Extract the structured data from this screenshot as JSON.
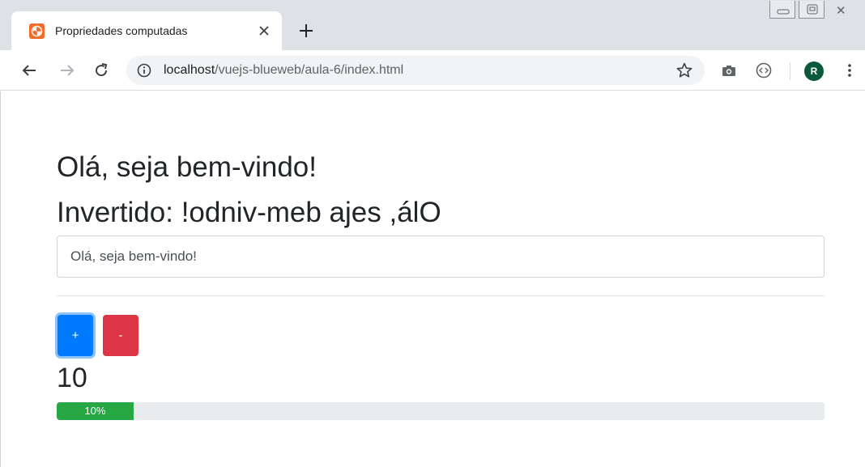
{
  "browser": {
    "tab_title": "Propriedades computadas",
    "url_host": "localhost",
    "url_path": "/vuejs-blueweb/aula-6/index.html",
    "avatar_initial": "R"
  },
  "page": {
    "greeting": "Olá, seja bem-vindo!",
    "inverted_text": "Invertido: !odniv-meb ajes ,álO",
    "message_input_value": "Olá, seja bem-vindo!",
    "plus_label": "+",
    "minus_label": "-",
    "counter_value": "10",
    "progress_label": "10%",
    "progress_fraction": 0.1
  },
  "colors": {
    "primary": "#007bff",
    "danger": "#dc3545",
    "success": "#28a745"
  }
}
